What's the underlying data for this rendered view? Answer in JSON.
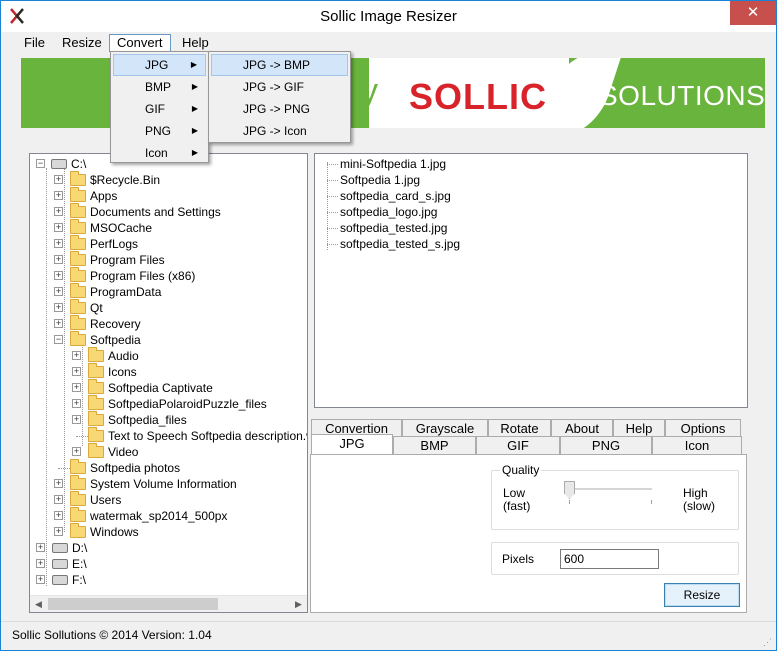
{
  "window": {
    "title": "Sollic Image Resizer",
    "close_glyph": "✕"
  },
  "menu": {
    "file": "File",
    "resize": "Resize",
    "convert": "Convert",
    "help": "Help"
  },
  "convert_menu": {
    "items": [
      {
        "label": "JPG"
      },
      {
        "label": "BMP"
      },
      {
        "label": "GIF"
      },
      {
        "label": "PNG"
      },
      {
        "label": "Icon"
      }
    ]
  },
  "jpg_submenu": {
    "items": [
      {
        "label": "JPG -> BMP"
      },
      {
        "label": "JPG -> GIF"
      },
      {
        "label": "JPG -> PNG"
      },
      {
        "label": "JPG -> Icon"
      }
    ]
  },
  "banner": {
    "partial_letter": "y",
    "brand": "SOLLIC",
    "tagline": "SOLUTIONS",
    "colors": {
      "green": "#6ab43d",
      "red": "#d8232a"
    }
  },
  "tree": {
    "root": "C:\\",
    "items": [
      "$Recycle.Bin",
      "Apps",
      "Documents and Settings",
      "MSOCache",
      "PerfLogs",
      "Program Files",
      "Program Files (x86)",
      "ProgramData",
      "Qt",
      "Recovery",
      "Softpedia"
    ],
    "softpedia_children": [
      "Audio",
      "Icons",
      "Softpedia Captivate",
      "SoftpediaPolaroidPuzzle_files",
      "Softpedia_files",
      "Text to Speech Softpedia description.wav",
      "Video"
    ],
    "after_items": [
      "Softpedia photos",
      "System Volume Information",
      "Users",
      "watermak_sp2014_500px",
      "Windows"
    ],
    "drives": [
      "D:\\",
      "E:\\",
      "F:\\"
    ]
  },
  "files": [
    "mini-Softpedia 1.jpg",
    "Softpedia 1.jpg",
    "softpedia_card_s.jpg",
    "softpedia_logo.jpg",
    "softpedia_tested.jpg",
    "softpedia_tested_s.jpg"
  ],
  "tabs_row1": [
    "Convertion",
    "Grayscale",
    "Rotate",
    "About",
    "Help",
    "Options"
  ],
  "tabs_row2": [
    "JPG",
    "BMP",
    "GIF",
    "PNG",
    "Icon"
  ],
  "quality": {
    "title": "Quality",
    "low": "Low",
    "low_sub": "(fast)",
    "high": "High",
    "high_sub": "(slow)",
    "level": 0
  },
  "pixels": {
    "label": "Pixels",
    "value": "600"
  },
  "resize_button": "Resize",
  "status": "Sollic Sollutions © 2014   Version: 1.04"
}
